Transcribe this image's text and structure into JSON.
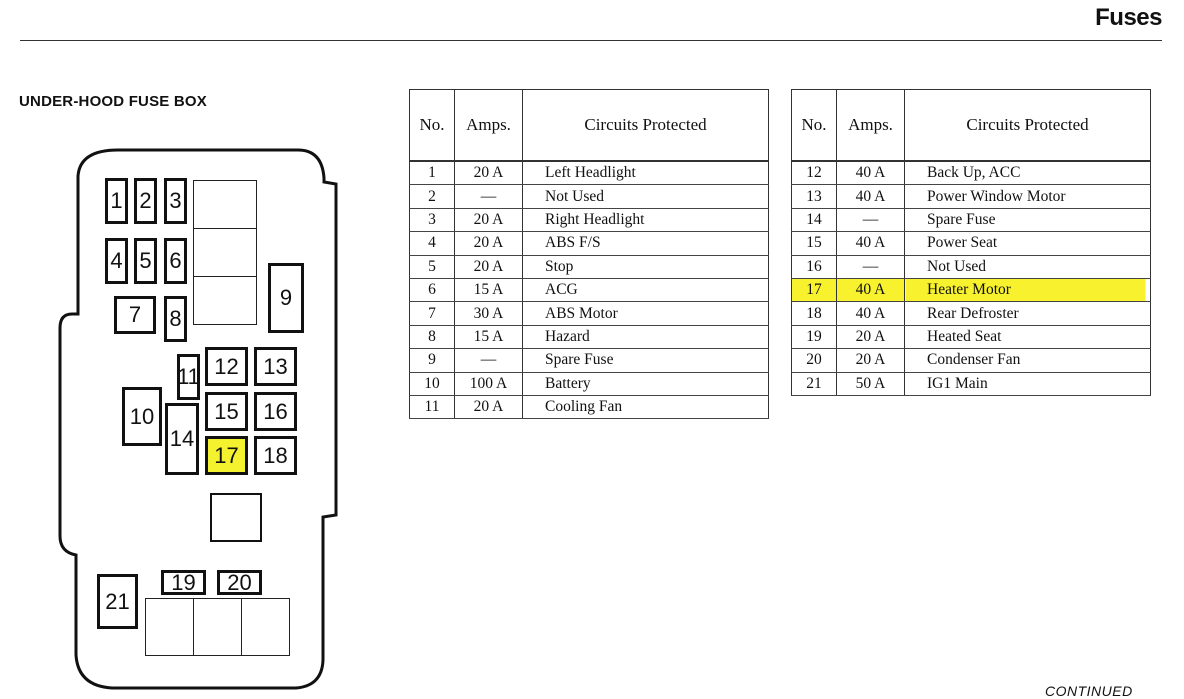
{
  "header": {
    "title": "Fuses"
  },
  "section": {
    "title": "UNDER-HOOD FUSE BOX"
  },
  "footer": {
    "continued": "CONTINUED"
  },
  "highlight_color": "#f4f22f",
  "diagram": {
    "fuses": [
      "1",
      "2",
      "3",
      "4",
      "5",
      "6",
      "7",
      "8",
      "9",
      "10",
      "11",
      "12",
      "13",
      "14",
      "15",
      "16",
      "17",
      "18",
      "19",
      "20",
      "21"
    ],
    "highlighted_fuse": "17"
  },
  "table": {
    "headers": {
      "no": "No.",
      "amps": "Amps.",
      "circuits": "Circuits Protected"
    },
    "left": [
      {
        "no": "1",
        "amps": "20 A",
        "circuit": "Left Headlight"
      },
      {
        "no": "2",
        "amps": "—",
        "circuit": "Not Used"
      },
      {
        "no": "3",
        "amps": "20 A",
        "circuit": "Right Headlight"
      },
      {
        "no": "4",
        "amps": "20 A",
        "circuit": "ABS F/S"
      },
      {
        "no": "5",
        "amps": "20 A",
        "circuit": "Stop"
      },
      {
        "no": "6",
        "amps": "15 A",
        "circuit": "ACG"
      },
      {
        "no": "7",
        "amps": "30 A",
        "circuit": "ABS Motor"
      },
      {
        "no": "8",
        "amps": "15 A",
        "circuit": "Hazard"
      },
      {
        "no": "9",
        "amps": "—",
        "circuit": "Spare Fuse"
      },
      {
        "no": "10",
        "amps": "100 A",
        "circuit": "Battery"
      },
      {
        "no": "11",
        "amps": "20 A",
        "circuit": "Cooling Fan"
      }
    ],
    "right": [
      {
        "no": "12",
        "amps": "40 A",
        "circuit": "Back Up, ACC"
      },
      {
        "no": "13",
        "amps": "40 A",
        "circuit": "Power Window Motor"
      },
      {
        "no": "14",
        "amps": "—",
        "circuit": "Spare Fuse"
      },
      {
        "no": "15",
        "amps": "40 A",
        "circuit": "Power Seat"
      },
      {
        "no": "16",
        "amps": "—",
        "circuit": "Not Used"
      },
      {
        "no": "17",
        "amps": "40 A",
        "circuit": "Heater Motor",
        "highlighted": true
      },
      {
        "no": "18",
        "amps": "40 A",
        "circuit": "Rear Defroster"
      },
      {
        "no": "19",
        "amps": "20 A",
        "circuit": "Heated Seat"
      },
      {
        "no": "20",
        "amps": "20 A",
        "circuit": "Condenser Fan"
      },
      {
        "no": "21",
        "amps": "50 A",
        "circuit": "IG1 Main"
      }
    ]
  }
}
